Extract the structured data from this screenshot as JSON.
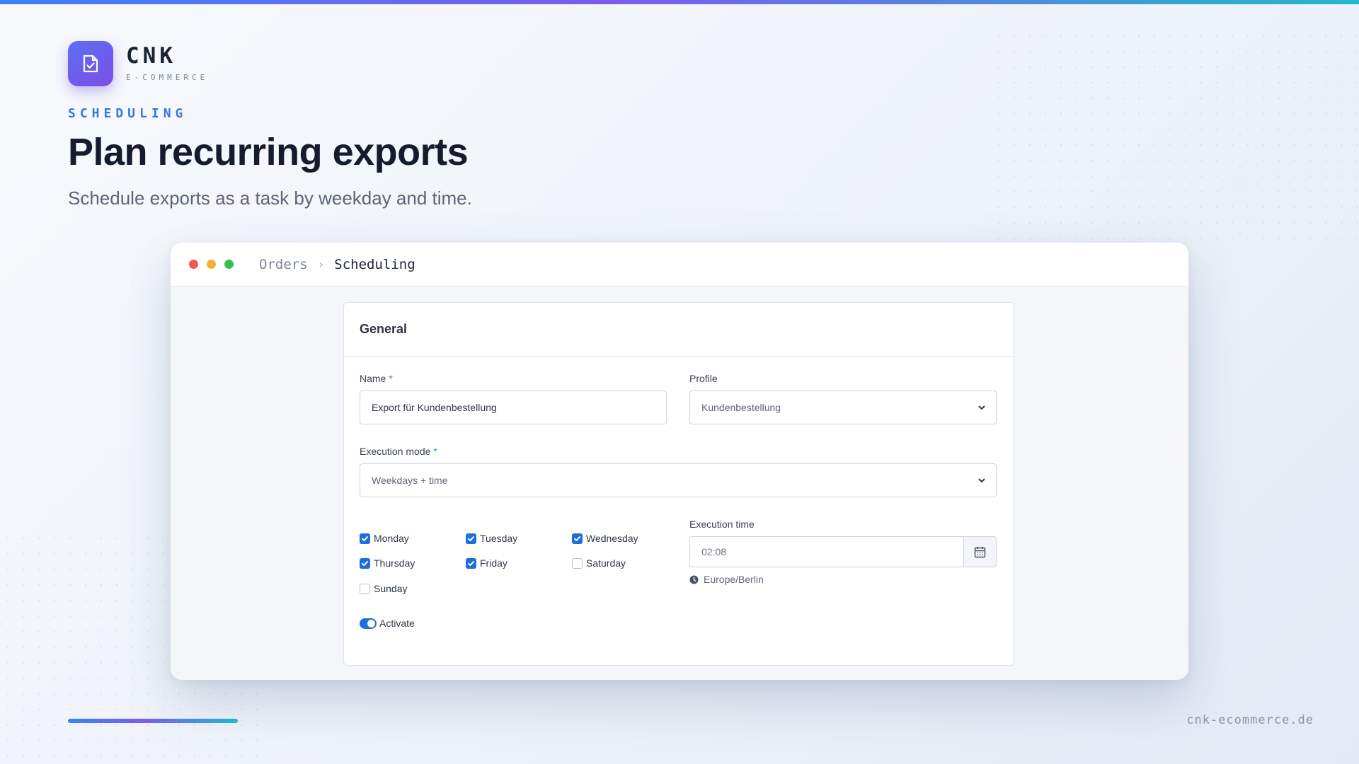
{
  "brand": {
    "name": "CNK",
    "tagline": "E-COMMERCE",
    "logo_icon": "document-check-icon"
  },
  "slide": {
    "eyebrow": "SCHEDULING",
    "headline": "Plan recurring exports",
    "subline": "Schedule exports as a task by weekday and time.",
    "footer_url": "cnk-ecommerce.de"
  },
  "window": {
    "breadcrumb": [
      "Orders",
      "Scheduling"
    ]
  },
  "form": {
    "section_title": "General",
    "name": {
      "label": "Name",
      "required_mark": "*",
      "value": "Export für Kundenbestellung"
    },
    "profile": {
      "label": "Profile",
      "value": "Kundenbestellung"
    },
    "execution_mode": {
      "label": "Execution mode",
      "required_mark": "*",
      "value": "Weekdays + time"
    },
    "weekdays": [
      {
        "label": "Monday",
        "checked": true
      },
      {
        "label": "Tuesday",
        "checked": true
      },
      {
        "label": "Wednesday",
        "checked": true
      },
      {
        "label": "Thursday",
        "checked": true
      },
      {
        "label": "Friday",
        "checked": true
      },
      {
        "label": "Saturday",
        "checked": false
      },
      {
        "label": "Sunday",
        "checked": false
      }
    ],
    "execution_time": {
      "label": "Execution time",
      "value": "02:08",
      "timezone": "Europe/Berlin"
    },
    "activate": {
      "label": "Activate",
      "on": true
    }
  },
  "colors": {
    "accent": "#1d6fe0",
    "eyebrow": "#3a78db",
    "logo_gradient": [
      "#5b6ef5",
      "#7b4fe6"
    ]
  }
}
